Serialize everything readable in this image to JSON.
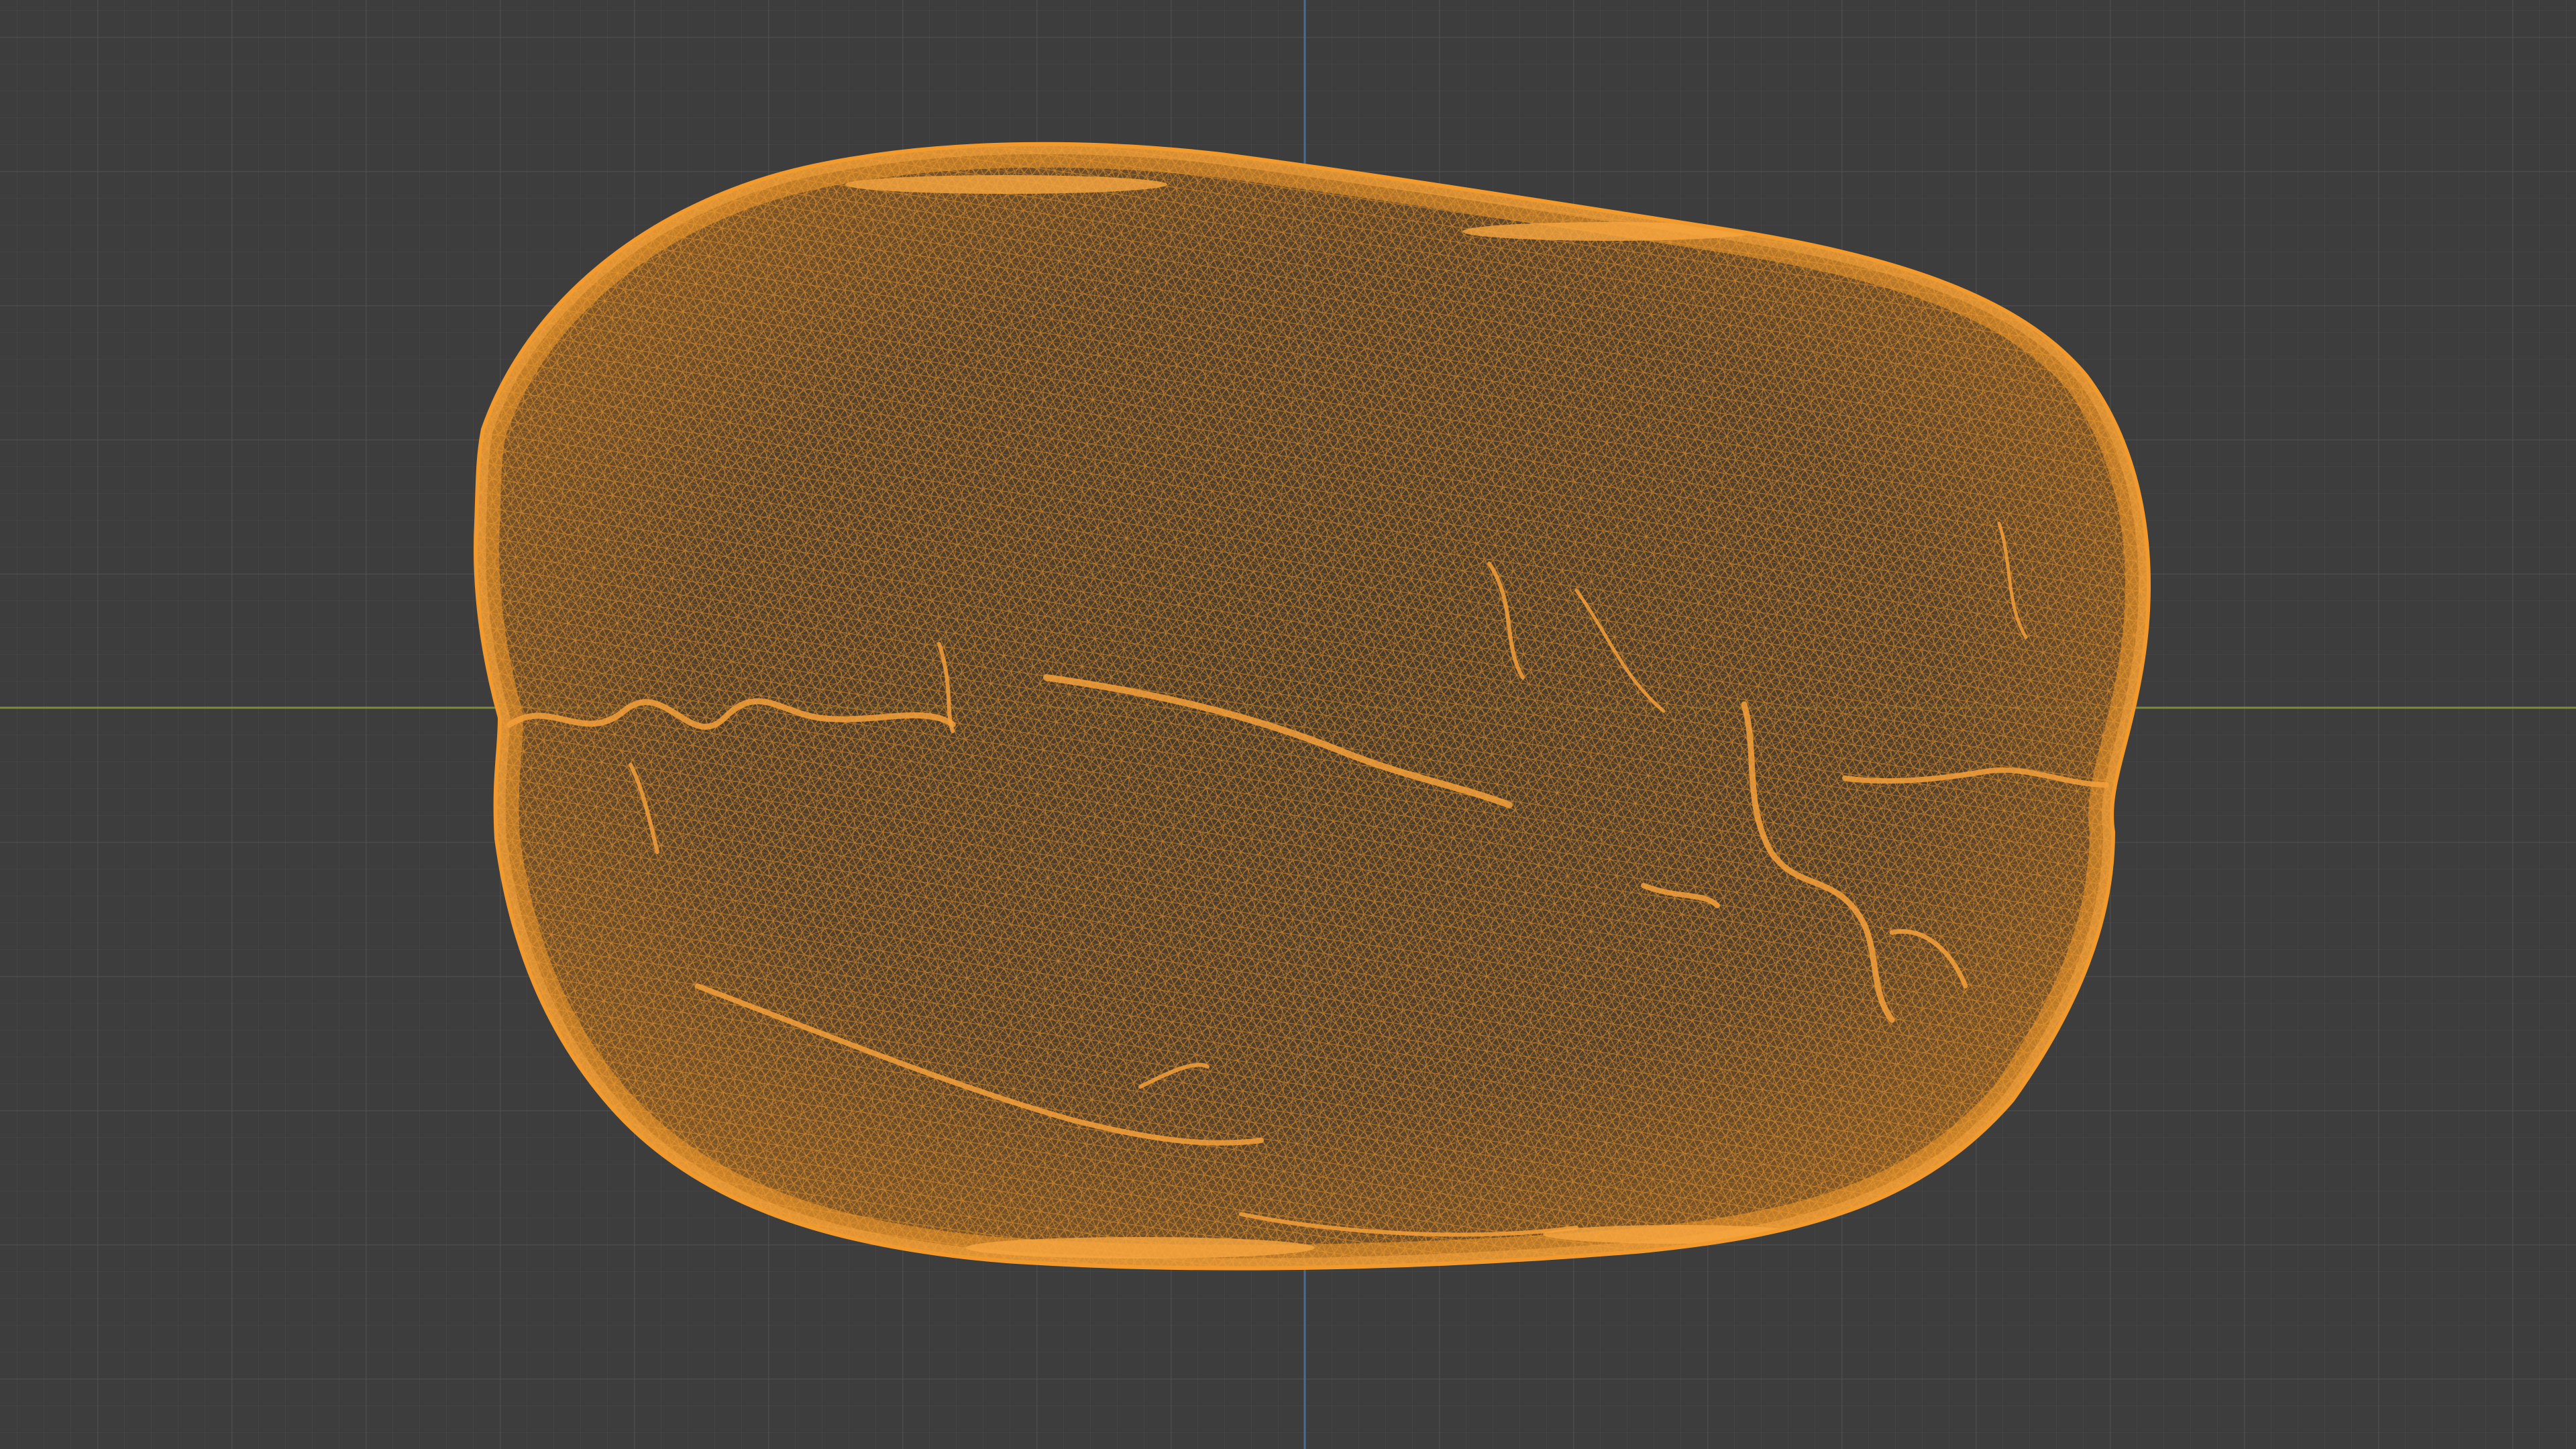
{
  "viewport": {
    "view": "orthographic",
    "shading": "wireframe",
    "object_selected": true
  },
  "colors": {
    "background": "#3d3d3d",
    "grid_minor": "#444444",
    "grid_major": "#4b4b4b",
    "axis_x": "#7f8a3c",
    "axis_z": "#4a6d8f",
    "wire": "#f39a2c",
    "wire_fill": "#6a4a22"
  }
}
